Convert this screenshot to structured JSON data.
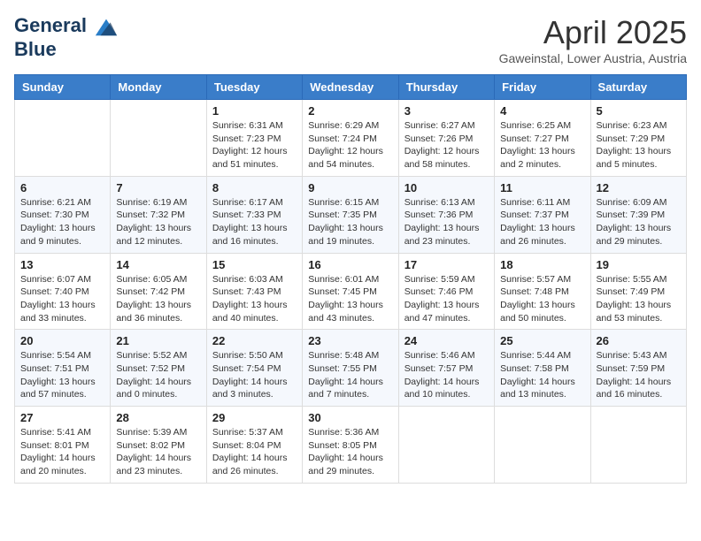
{
  "logo": {
    "line1": "General",
    "line2": "Blue"
  },
  "title": "April 2025",
  "subtitle": "Gaweinstal, Lower Austria, Austria",
  "weekdays": [
    "Sunday",
    "Monday",
    "Tuesday",
    "Wednesday",
    "Thursday",
    "Friday",
    "Saturday"
  ],
  "weeks": [
    [
      {
        "day": "",
        "info": ""
      },
      {
        "day": "",
        "info": ""
      },
      {
        "day": "1",
        "info": "Sunrise: 6:31 AM\nSunset: 7:23 PM\nDaylight: 12 hours and 51 minutes."
      },
      {
        "day": "2",
        "info": "Sunrise: 6:29 AM\nSunset: 7:24 PM\nDaylight: 12 hours and 54 minutes."
      },
      {
        "day": "3",
        "info": "Sunrise: 6:27 AM\nSunset: 7:26 PM\nDaylight: 12 hours and 58 minutes."
      },
      {
        "day": "4",
        "info": "Sunrise: 6:25 AM\nSunset: 7:27 PM\nDaylight: 13 hours and 2 minutes."
      },
      {
        "day": "5",
        "info": "Sunrise: 6:23 AM\nSunset: 7:29 PM\nDaylight: 13 hours and 5 minutes."
      }
    ],
    [
      {
        "day": "6",
        "info": "Sunrise: 6:21 AM\nSunset: 7:30 PM\nDaylight: 13 hours and 9 minutes."
      },
      {
        "day": "7",
        "info": "Sunrise: 6:19 AM\nSunset: 7:32 PM\nDaylight: 13 hours and 12 minutes."
      },
      {
        "day": "8",
        "info": "Sunrise: 6:17 AM\nSunset: 7:33 PM\nDaylight: 13 hours and 16 minutes."
      },
      {
        "day": "9",
        "info": "Sunrise: 6:15 AM\nSunset: 7:35 PM\nDaylight: 13 hours and 19 minutes."
      },
      {
        "day": "10",
        "info": "Sunrise: 6:13 AM\nSunset: 7:36 PM\nDaylight: 13 hours and 23 minutes."
      },
      {
        "day": "11",
        "info": "Sunrise: 6:11 AM\nSunset: 7:37 PM\nDaylight: 13 hours and 26 minutes."
      },
      {
        "day": "12",
        "info": "Sunrise: 6:09 AM\nSunset: 7:39 PM\nDaylight: 13 hours and 29 minutes."
      }
    ],
    [
      {
        "day": "13",
        "info": "Sunrise: 6:07 AM\nSunset: 7:40 PM\nDaylight: 13 hours and 33 minutes."
      },
      {
        "day": "14",
        "info": "Sunrise: 6:05 AM\nSunset: 7:42 PM\nDaylight: 13 hours and 36 minutes."
      },
      {
        "day": "15",
        "info": "Sunrise: 6:03 AM\nSunset: 7:43 PM\nDaylight: 13 hours and 40 minutes."
      },
      {
        "day": "16",
        "info": "Sunrise: 6:01 AM\nSunset: 7:45 PM\nDaylight: 13 hours and 43 minutes."
      },
      {
        "day": "17",
        "info": "Sunrise: 5:59 AM\nSunset: 7:46 PM\nDaylight: 13 hours and 47 minutes."
      },
      {
        "day": "18",
        "info": "Sunrise: 5:57 AM\nSunset: 7:48 PM\nDaylight: 13 hours and 50 minutes."
      },
      {
        "day": "19",
        "info": "Sunrise: 5:55 AM\nSunset: 7:49 PM\nDaylight: 13 hours and 53 minutes."
      }
    ],
    [
      {
        "day": "20",
        "info": "Sunrise: 5:54 AM\nSunset: 7:51 PM\nDaylight: 13 hours and 57 minutes."
      },
      {
        "day": "21",
        "info": "Sunrise: 5:52 AM\nSunset: 7:52 PM\nDaylight: 14 hours and 0 minutes."
      },
      {
        "day": "22",
        "info": "Sunrise: 5:50 AM\nSunset: 7:54 PM\nDaylight: 14 hours and 3 minutes."
      },
      {
        "day": "23",
        "info": "Sunrise: 5:48 AM\nSunset: 7:55 PM\nDaylight: 14 hours and 7 minutes."
      },
      {
        "day": "24",
        "info": "Sunrise: 5:46 AM\nSunset: 7:57 PM\nDaylight: 14 hours and 10 minutes."
      },
      {
        "day": "25",
        "info": "Sunrise: 5:44 AM\nSunset: 7:58 PM\nDaylight: 14 hours and 13 minutes."
      },
      {
        "day": "26",
        "info": "Sunrise: 5:43 AM\nSunset: 7:59 PM\nDaylight: 14 hours and 16 minutes."
      }
    ],
    [
      {
        "day": "27",
        "info": "Sunrise: 5:41 AM\nSunset: 8:01 PM\nDaylight: 14 hours and 20 minutes."
      },
      {
        "day": "28",
        "info": "Sunrise: 5:39 AM\nSunset: 8:02 PM\nDaylight: 14 hours and 23 minutes."
      },
      {
        "day": "29",
        "info": "Sunrise: 5:37 AM\nSunset: 8:04 PM\nDaylight: 14 hours and 26 minutes."
      },
      {
        "day": "30",
        "info": "Sunrise: 5:36 AM\nSunset: 8:05 PM\nDaylight: 14 hours and 29 minutes."
      },
      {
        "day": "",
        "info": ""
      },
      {
        "day": "",
        "info": ""
      },
      {
        "day": "",
        "info": ""
      }
    ]
  ]
}
